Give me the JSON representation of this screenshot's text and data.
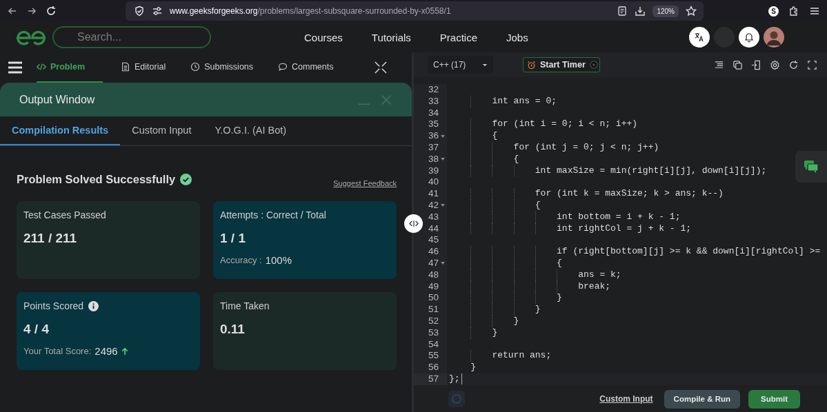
{
  "browser": {
    "url_host": "www.geeksforgeeks.org",
    "url_path": "/problems/largest-subsquare-surrounded-by-x0558/1",
    "zoom": "120%",
    "profile_initial": "S"
  },
  "nav": {
    "search_placeholder": "Search...",
    "links": [
      "Courses",
      "Tutorials",
      "Practice",
      "Jobs"
    ]
  },
  "problem_tabs": [
    {
      "label": "Problem",
      "selected": true
    },
    {
      "label": "Editorial",
      "selected": false
    },
    {
      "label": "Submissions",
      "selected": false
    },
    {
      "label": "Comments",
      "selected": false
    }
  ],
  "output": {
    "title": "Output Window",
    "tabs": [
      {
        "label": "Compilation Results",
        "selected": true
      },
      {
        "label": "Custom Input",
        "selected": false
      },
      {
        "label": "Y.O.G.I. (AI Bot)",
        "selected": false
      }
    ],
    "status": "Problem Solved Successfully",
    "feedback_link": "Suggest Feedback",
    "cards": [
      {
        "label": "Test Cases Passed",
        "value": "211 / 211",
        "color": "#1c2a27",
        "info": false
      },
      {
        "label": "Attempts : Correct / Total",
        "value": "1 / 1",
        "color": "#06343f",
        "info": false,
        "sub_label": "Accuracy :",
        "sub_value": "100%",
        "rising": false
      },
      {
        "label": "Points Scored",
        "value": "4 / 4",
        "color": "#06343f",
        "info": true,
        "sub_label": "Your Total Score:",
        "sub_value": "2496",
        "rising": true
      },
      {
        "label": "Time Taken",
        "value": "0.11",
        "color": "#1c2a27",
        "info": false
      }
    ]
  },
  "editor": {
    "language": "C++ (17)",
    "timer": "Start Timer",
    "lines": [
      {
        "n": "32",
        "fold": false,
        "active": false
      },
      {
        "n": "33",
        "fold": false,
        "active": false,
        "text": "        int ans = 0;"
      },
      {
        "n": "34",
        "fold": false,
        "active": false
      },
      {
        "n": "35",
        "fold": false,
        "active": false,
        "text": "        for (int i = 0; i < n; i++)"
      },
      {
        "n": "36",
        "fold": true,
        "active": false,
        "text": "        {"
      },
      {
        "n": "37",
        "fold": false,
        "active": false,
        "text": "            for (int j = 0; j < n; j++)"
      },
      {
        "n": "38",
        "fold": true,
        "active": false,
        "text": "            {"
      },
      {
        "n": "39",
        "fold": false,
        "active": false,
        "text": "                int maxSize = min(right[i][j], down[i][j]);"
      },
      {
        "n": "40",
        "fold": false,
        "active": false
      },
      {
        "n": "41",
        "fold": false,
        "active": false,
        "text": "                for (int k = maxSize; k > ans; k--)"
      },
      {
        "n": "42",
        "fold": true,
        "active": false,
        "text": "                {"
      },
      {
        "n": "43",
        "fold": false,
        "active": false,
        "text": "                    int bottom = i + k - 1;"
      },
      {
        "n": "44",
        "fold": false,
        "active": false,
        "text": "                    int rightCol = j + k - 1;"
      },
      {
        "n": "45",
        "fold": false,
        "active": false
      },
      {
        "n": "46",
        "fold": false,
        "active": false,
        "text": "                    if (right[bottom][j] >= k && down[i][rightCol] >="
      },
      {
        "n": "47",
        "fold": true,
        "active": false,
        "text": "                    {"
      },
      {
        "n": "48",
        "fold": false,
        "active": false,
        "text": "                        ans = k;"
      },
      {
        "n": "49",
        "fold": false,
        "active": false,
        "text": "                        break;"
      },
      {
        "n": "50",
        "fold": false,
        "active": false,
        "text": "                    }"
      },
      {
        "n": "51",
        "fold": false,
        "active": false,
        "text": "                }"
      },
      {
        "n": "52",
        "fold": false,
        "active": false,
        "text": "            }"
      },
      {
        "n": "53",
        "fold": false,
        "active": false,
        "text": "        }"
      },
      {
        "n": "54",
        "fold": false,
        "active": false
      },
      {
        "n": "55",
        "fold": false,
        "active": false,
        "text": "        return ans;"
      },
      {
        "n": "56",
        "fold": false,
        "active": false,
        "text": "    }"
      },
      {
        "n": "57",
        "fold": false,
        "active": true,
        "text": "};"
      }
    ]
  },
  "footer": {
    "custom_input": "Custom Input",
    "compile": "Compile & Run",
    "submit": "Submit"
  }
}
